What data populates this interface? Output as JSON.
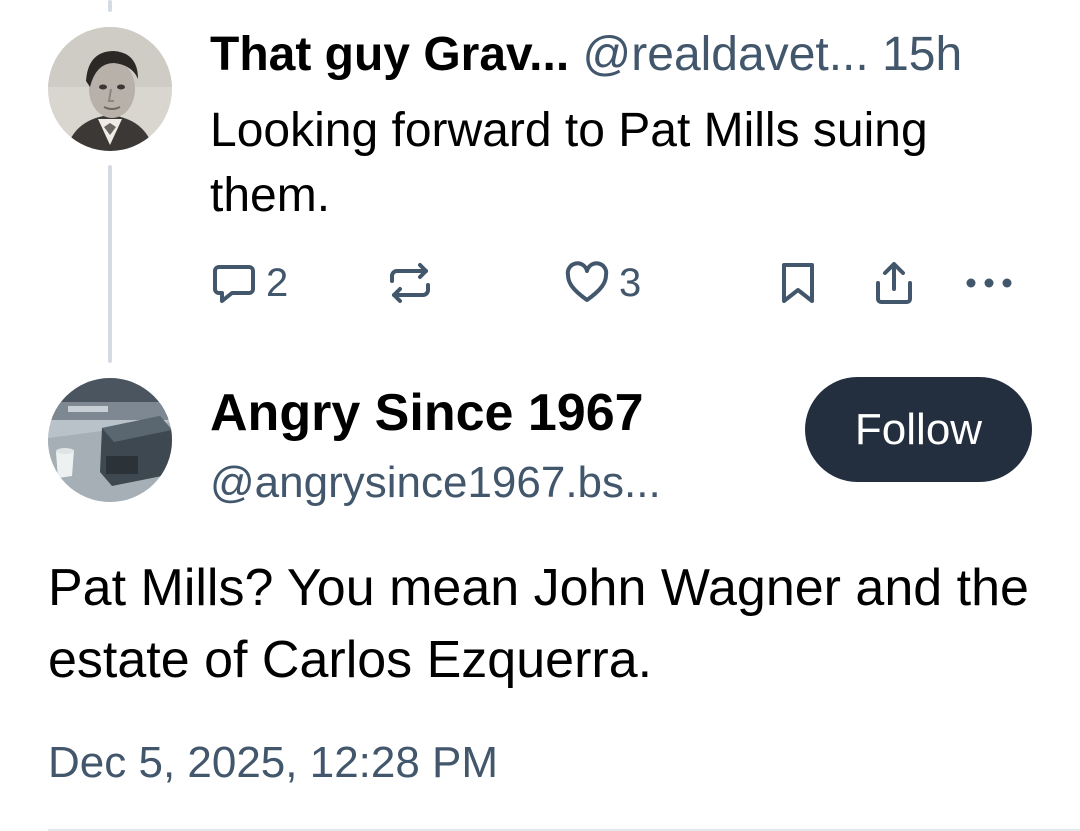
{
  "parent_post": {
    "display_name": "That guy Grav...",
    "handle": "@realdavet...",
    "time": "15h",
    "text": "Looking forward to Pat Mills suing them.",
    "avatar_icon": "avatar-vintage-portrait",
    "actions": {
      "reply_count": "2",
      "repost_count": "",
      "like_count": "3",
      "icons": [
        "reply-icon",
        "repost-icon",
        "like-icon",
        "bookmark-icon",
        "share-icon",
        "more-icon"
      ]
    }
  },
  "main_post": {
    "display_name": "Angry Since 1967",
    "handle": "@angrysince1967.bs...",
    "follow_label": "Follow",
    "text": "Pat Mills? You mean John Wagner and the estate of Carlos Ezquerra.",
    "timestamp": "Dec 5, 2025, 12:28 PM",
    "avatar_icon": "avatar-desk-photo"
  },
  "colors": {
    "muted_text": "#42576c",
    "follow_bg": "#232f3e",
    "thread_line": "#d4dbe2",
    "divider": "#e3e8ed"
  }
}
